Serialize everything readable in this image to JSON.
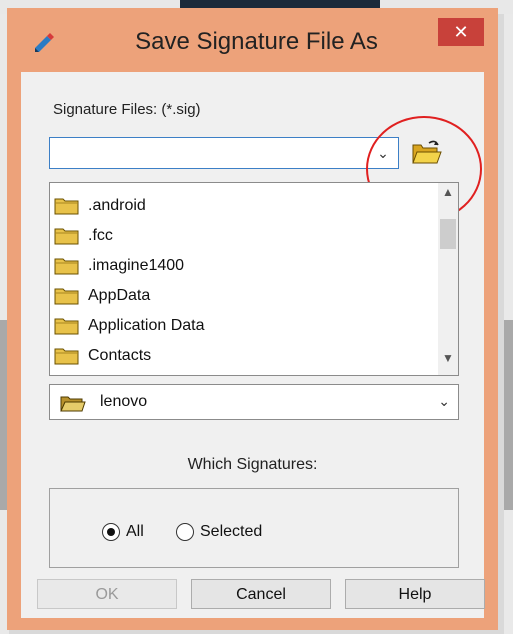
{
  "dialog": {
    "title": "Save Signature File As",
    "close_glyph": "✕",
    "signature_files_label": "Signature Files: (*.sig)",
    "file_name_value": "",
    "combo_arrow": "⌄",
    "folders": [
      ".android",
      ".fcc",
      ".imagine1400",
      "AppData",
      "Application Data",
      "Contacts"
    ],
    "scroll_up": "▲",
    "scroll_down": "▼",
    "current_folder": "lenovo",
    "which_signatures_label": "Which Signatures:",
    "radio_all": "All",
    "radio_selected": "Selected",
    "selected_option": "All",
    "buttons": {
      "ok": "OK",
      "cancel": "Cancel",
      "help": "Help"
    }
  },
  "icons": {
    "app": "signature-pen-icon",
    "open_folder": "open-folder-icon",
    "folder": "folder-icon",
    "drive_folder": "open-folder-icon"
  },
  "colors": {
    "frame": "#eda27a",
    "close": "#c8413a",
    "highlight_circle": "#e02020",
    "focus_border": "#3c7fc6"
  }
}
